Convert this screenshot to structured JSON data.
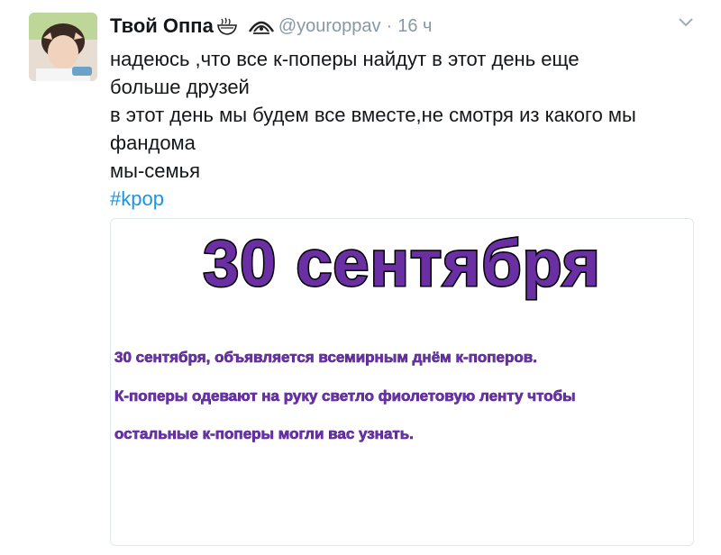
{
  "tweet": {
    "author_name": "Твой Оппа",
    "handle": "@youroppav",
    "separator": "·",
    "time": "16 ч",
    "text_lines": [
      "надеюсь ,что все к-поперы найдут в этот день еще",
      "больше друзей",
      "в этот день мы будем все вместе,не смотря из какого мы",
      "фандома",
      "мы-семья"
    ],
    "hashtag": "#kpop"
  },
  "media": {
    "title": "30 сентября",
    "lines": [
      "30 сентября, объявляется всемирным днём к-поперов.",
      "К-поперы одевают на руку светло фиолетовую ленту чтобы",
      "остальные к-поперы могли вас узнать."
    ]
  },
  "icons": {
    "name_emoji": "ramen-bowl-icon",
    "fandom_badge": "fan-icon",
    "menu": "chevron-down-icon"
  },
  "colors": {
    "link": "#1b95e0",
    "muted": "#8899a6",
    "title_purple": "#6a2fa3",
    "text_purple": "#6d2fb1"
  }
}
